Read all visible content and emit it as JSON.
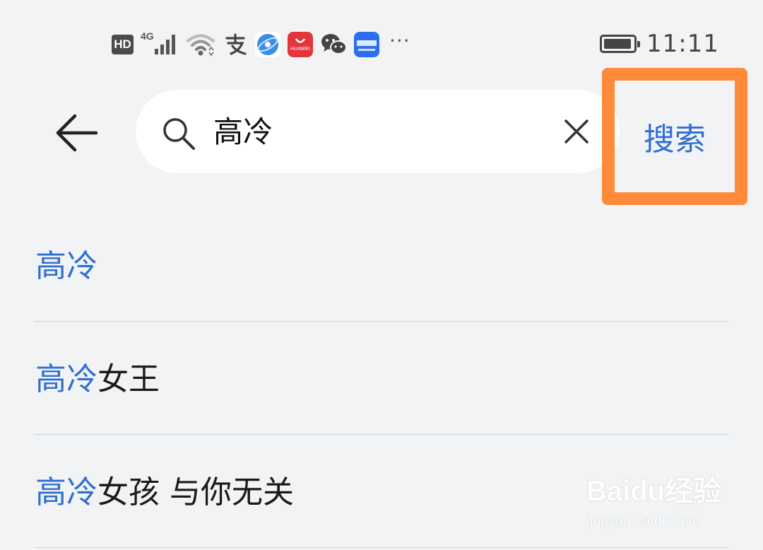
{
  "status_bar": {
    "hd_label": "HD",
    "network_label": "4G",
    "icons": [
      "signal-icon",
      "wifi-icon",
      "alipay-icon",
      "browser-icon",
      "huawei-appgallery-icon",
      "wechat-icon",
      "tmall-icon"
    ],
    "huawei_label": "HUAWEI",
    "more_label": "···",
    "time": "11:11",
    "battery_level": 0.95
  },
  "search": {
    "query": "高冷",
    "submit_label": "搜索",
    "highlight_color": "#ff8a3a",
    "accent_color": "#2f6fd0"
  },
  "suggestions": [
    {
      "match": "高冷",
      "rest": ""
    },
    {
      "match": "高冷",
      "rest": "女王"
    },
    {
      "match": "高冷",
      "rest": "女孩 与你无关"
    }
  ],
  "watermark": {
    "brand": "Baidu经验",
    "url": "jingyan.baidu.com"
  }
}
